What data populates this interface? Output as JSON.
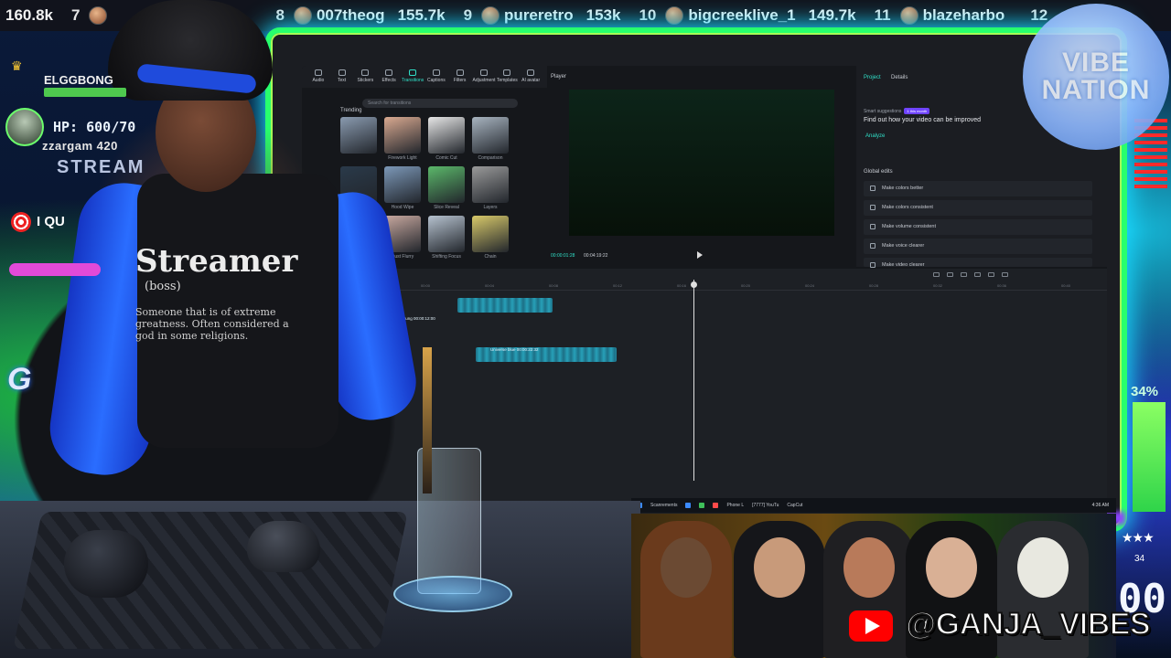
{
  "ticker": {
    "lead_score": "160.8k",
    "items": [
      {
        "rank": "7",
        "name": "",
        "score": ""
      },
      {
        "rank": "8",
        "name": "007theog",
        "score": "155.7k"
      },
      {
        "rank": "9",
        "name": "pureretro",
        "score": "153k"
      },
      {
        "rank": "10",
        "name": "bigcreeklive_1",
        "score": "149.7k"
      },
      {
        "rank": "11",
        "name": "blazeharbo",
        "score": ""
      },
      {
        "rank": "12",
        "name": "",
        "score": ""
      }
    ]
  },
  "overlay_left": {
    "top_user": "ELGGBONG",
    "hp": "HP: 600/70",
    "user_tag": "zzargam 420",
    "stream_word": "STREAM",
    "qui": "I QU",
    "logo_letter": "G"
  },
  "overlay_right": {
    "vibe_line1": "VIBE",
    "vibe_line2": "NATION",
    "percent": "34%",
    "side_number": "34",
    "side_big": "00",
    "stars": "★★★"
  },
  "editor": {
    "toolbar": [
      {
        "label": "Audio",
        "active": false
      },
      {
        "label": "Text",
        "active": false
      },
      {
        "label": "Stickers",
        "active": false
      },
      {
        "label": "Effects",
        "active": false
      },
      {
        "label": "Transitions",
        "active": true
      },
      {
        "label": "Captions",
        "active": false
      },
      {
        "label": "Filters",
        "active": false
      },
      {
        "label": "Adjustment",
        "active": false
      },
      {
        "label": "Templates",
        "active": false
      },
      {
        "label": "AI avatar",
        "active": false
      }
    ],
    "search_placeholder": "Search for transitions",
    "trending_label": "Trending",
    "thumbnails": [
      {
        "label": "",
        "color": "#8a9bb0"
      },
      {
        "label": "Firework Light",
        "color": "#d9a990"
      },
      {
        "label": "Comic Cut",
        "color": "#e6e6e6"
      },
      {
        "label": "Comparison",
        "color": "#a8b4c0"
      },
      {
        "label": "",
        "color": "#2a3a4a"
      },
      {
        "label": "Hood Wipe",
        "color": "#7c98b8"
      },
      {
        "label": "Slice Reveal",
        "color": "#5bb86a"
      },
      {
        "label": "Layers",
        "color": "#9a9a9a"
      },
      {
        "label": "",
        "color": "#4a6a9a"
      },
      {
        "label": "Dust Flurry",
        "color": "#c9a9a0"
      },
      {
        "label": "Shifting Focus",
        "color": "#b6c2cf"
      },
      {
        "label": "Chain",
        "color": "#d8c96a"
      }
    ],
    "player_label": "Player",
    "time_current": "00:00:01:28",
    "time_total": "00:04:19:22",
    "right_tabs": [
      "Project",
      "Details"
    ],
    "smart_label": "Smart suggestions",
    "smart_badge": "1 this month",
    "find_out": "Find out how your video can be improved",
    "analyze": "Analyze",
    "global_edits": "Global edits",
    "global_items": [
      "Make colors better",
      "Make colors consistent",
      "Make volume consistent",
      "Make voice clearer",
      "Make video clearer"
    ],
    "ruler_ticks": [
      "00:00",
      "00:04",
      "00:08",
      "00:12",
      "00:16",
      "00:20",
      "00:24",
      "00:28",
      "00:32",
      "00:36",
      "00:40"
    ],
    "clip_labels": [
      "Tap to the studio Pung 00:00:12:00",
      "Universe blue 00:00:22:32"
    ],
    "taskbar_items": [
      "Scanrements",
      "Phone L",
      "[7777] YouTu",
      "CapCut"
    ],
    "taskbar_time": "4:36 AM"
  },
  "shirt": {
    "title": "Streamer",
    "sub": "(boss)",
    "definition": "Someone that is of extreme greatness. Often considered a god in some religions."
  },
  "banner": {
    "handle": "@GANJA_VIBES"
  },
  "colors": {
    "frame_green": "#28ff6d",
    "frame_cyan": "#19d9ff",
    "accent_teal": "#30e0c8",
    "youtube_red": "#ff0000"
  }
}
